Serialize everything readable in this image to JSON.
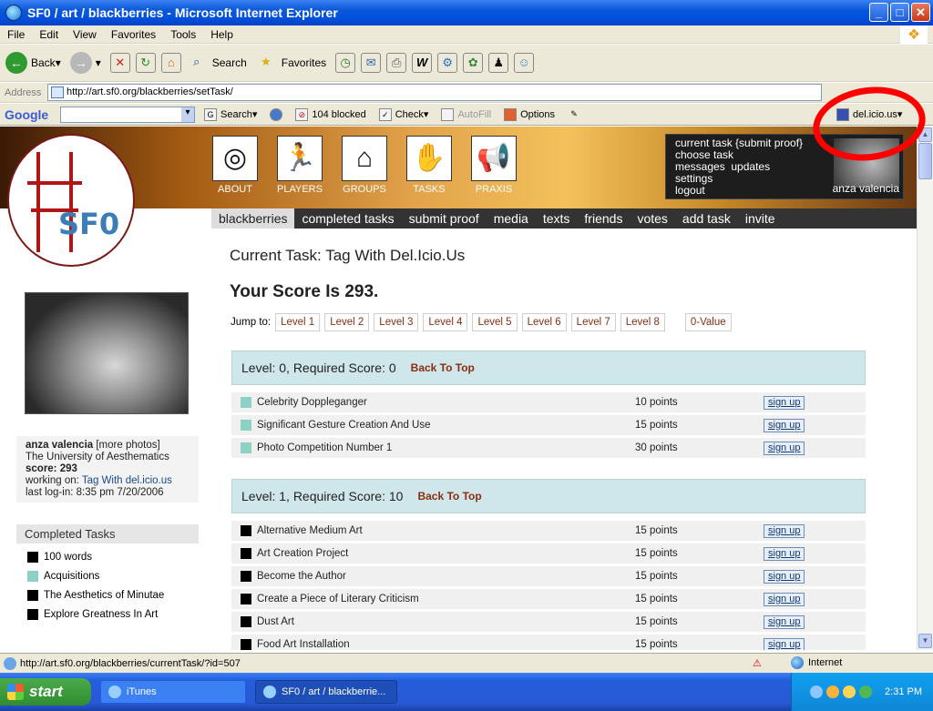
{
  "window": {
    "title": "SF0 / art / blackberries - Microsoft Internet Explorer",
    "min": "_",
    "max": "□",
    "close": "✕"
  },
  "menu": [
    "File",
    "Edit",
    "View",
    "Favorites",
    "Tools",
    "Help"
  ],
  "toolbar": {
    "back": "Back",
    "search": "Search",
    "favorites": "Favorites"
  },
  "address": {
    "label": "Address",
    "url": "http://art.sf0.org/blackberries/setTask/"
  },
  "google": {
    "logo": "Google",
    "search": "Search",
    "blocked": "104 blocked",
    "check": "Check",
    "autofill": "AutoFill",
    "options": "Options",
    "delicious": "del.icio.us"
  },
  "site": {
    "logo_text": "SF0",
    "nav_icons": [
      "ABOUT",
      "PLAYERS",
      "GROUPS",
      "TASKS",
      "PRAXIS"
    ],
    "user_menu": [
      "current task {submit proof}",
      "choose task",
      "messages",
      "updates",
      "settings",
      "logout"
    ],
    "user_name": "anza valencia",
    "tabs": [
      "blackberries",
      "completed tasks",
      "submit proof",
      "media",
      "texts",
      "friends",
      "votes",
      "add task",
      "invite"
    ]
  },
  "profile": {
    "name": "anza valencia",
    "more_photos": "[more photos]",
    "school": "The University of Aesthematics",
    "score_label": "score:",
    "score_value": "293",
    "working_label": "working on:",
    "working_task": "Tag With del.icio.us",
    "login_label": "last log-in:",
    "login_value": "8:35 pm 7/20/2006"
  },
  "completed": {
    "heading": "Completed Tasks",
    "items": [
      {
        "name": "100 words",
        "color": "black"
      },
      {
        "name": "Acquisitions",
        "color": "teal"
      },
      {
        "name": "The Aesthetics of Minutae",
        "color": "black"
      },
      {
        "name": "Explore Greatness In Art",
        "color": "black"
      }
    ]
  },
  "main": {
    "current_task": "Current Task: Tag With Del.Icio.Us",
    "score": "Your Score Is 293.",
    "jump_label": "Jump to:",
    "jump_levels": [
      "Level 1",
      "Level 2",
      "Level 3",
      "Level 4",
      "Level 5",
      "Level 6",
      "Level 7",
      "Level 8"
    ],
    "zero_value": "0-Value",
    "back_to_top": "Back To Top",
    "sign_up": "sign up",
    "level0": {
      "heading": "Level: 0, Required Score: 0",
      "tasks": [
        {
          "name": "Celebrity Doppleganger",
          "points": "10 points"
        },
        {
          "name": "Significant Gesture Creation And Use",
          "points": "15 points"
        },
        {
          "name": "Photo Competition Number 1",
          "points": "30 points"
        }
      ]
    },
    "level1": {
      "heading": "Level: 1, Required Score: 10",
      "tasks": [
        {
          "name": "Alternative Medium Art",
          "points": "15 points"
        },
        {
          "name": "Art Creation Project",
          "points": "15 points"
        },
        {
          "name": "Become the Author",
          "points": "15 points"
        },
        {
          "name": "Create a Piece of Literary Criticism",
          "points": "15 points"
        },
        {
          "name": "Dust Art",
          "points": "15 points"
        },
        {
          "name": "Food Art Installation",
          "points": "15 points"
        }
      ]
    }
  },
  "status": {
    "url": "http://art.sf0.org/blackberries/currentTask/?id=507",
    "zone": "Internet"
  },
  "taskbar": {
    "start": "start",
    "items": [
      "iTunes",
      "SF0 / art / blackberrie..."
    ],
    "time": "2:31 PM"
  },
  "colors": {
    "level_header_bg": "#cfe6ea",
    "back_to_top": "#8a2e10",
    "annotation": "#ff0000"
  }
}
